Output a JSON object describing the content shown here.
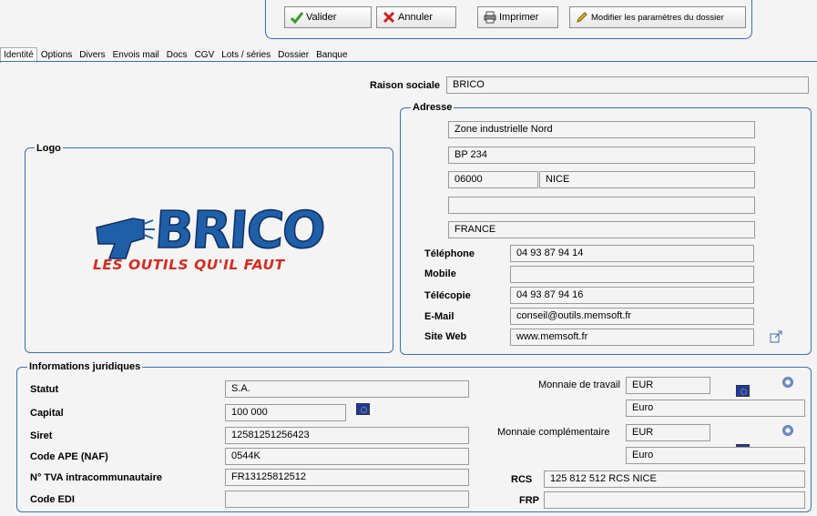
{
  "toolbar": {
    "validate": "Valider",
    "cancel": "Annuler",
    "print": "Imprimer",
    "settings": "Modifier les paramètres du dossier"
  },
  "tabs": [
    "Identité",
    "Options",
    "Divers",
    "Envois mail",
    "Docs",
    "CGV",
    "Lots / séries",
    "Dossier",
    "Banque"
  ],
  "company": {
    "label": "Raison sociale",
    "value": "BRICO"
  },
  "address": {
    "title": "Adresse",
    "line1": "Zone industrielle Nord",
    "line2": "BP 234",
    "postcode": "06000",
    "city": "NICE",
    "line3": "",
    "country": "FRANCE"
  },
  "logo": {
    "title": "Logo",
    "brand": "BRICO",
    "tagline": "LES OUTILS QU'IL FAUT"
  },
  "contact": {
    "phone_label": "Téléphone",
    "phone": "04 93 87 94 14",
    "mobile_label": "Mobile",
    "mobile": "",
    "fax_label": "Télécopie",
    "fax": "04 93 87 94 16",
    "email_label": "E-Mail",
    "email": "conseil@outils.memsoft.fr",
    "web_label": "Site Web",
    "web": "www.memsoft.fr"
  },
  "legal": {
    "title": "Informations juridiques",
    "status_label": "Statut",
    "status": "S.A.",
    "capital_label": "Capital",
    "capital": "100 000",
    "siret_label": "Siret",
    "siret": "12581251256423",
    "ape_label": "Code APE (NAF)",
    "ape": "0544K",
    "vat_label": "N° TVA intracommunautaire",
    "vat": "FR13125812512",
    "edi_label": "Code EDI",
    "edi": ""
  },
  "currency": {
    "work_label": "Monnaie de travail",
    "work_code": "EUR",
    "work_name": "Euro",
    "extra_label": "Monnaie complémentaire",
    "extra_code": "EUR",
    "extra_name": "Euro",
    "rcs_label": "RCS",
    "rcs": "125 812 512  RCS NICE",
    "frp_label": "FRP",
    "frp": ""
  },
  "colors": {
    "frame": "#3a6fb5",
    "logo_blue": "#1f5fa8",
    "logo_red": "#d92b1f"
  }
}
